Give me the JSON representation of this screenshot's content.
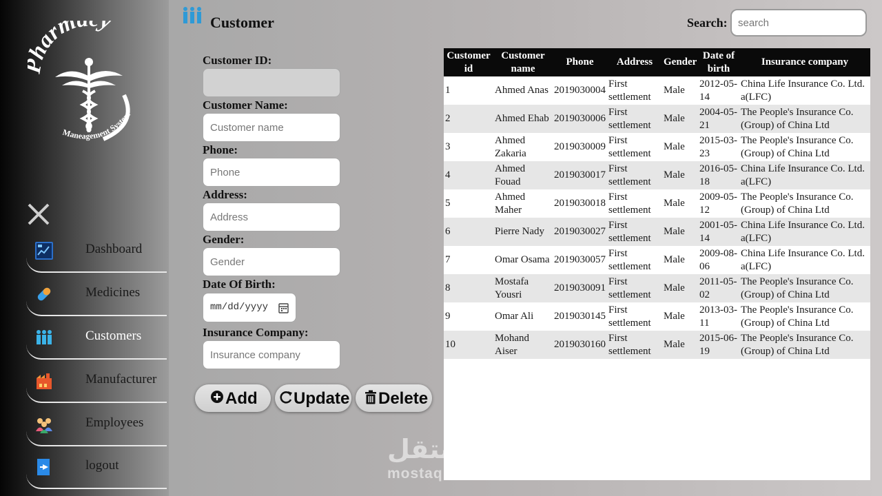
{
  "sidebar": {
    "logo_text": "Pharmacy Maneagement System",
    "items": [
      {
        "label": "Dashboard",
        "icon": "dashboard-icon"
      },
      {
        "label": "Medicines",
        "icon": "pill-icon"
      },
      {
        "label": "Customers",
        "icon": "customers-icon"
      },
      {
        "label": "Manufacturer",
        "icon": "factory-icon"
      },
      {
        "label": "Employees",
        "icon": "employees-icon"
      },
      {
        "label": "logout",
        "icon": "logout-icon"
      }
    ],
    "active_item": "Customers"
  },
  "header": {
    "title": "Customer",
    "icon": "customers-icon",
    "search_label": "Search:",
    "search_placeholder": "search",
    "search_value": ""
  },
  "form": {
    "customer_id_label": "Customer ID:",
    "customer_id_value": "",
    "customer_name_label": "Customer Name:",
    "customer_name_placeholder": "Customer name",
    "phone_label": "Phone:",
    "phone_placeholder": "Phone",
    "address_label": "Address:",
    "address_placeholder": "Address",
    "gender_label": "Gender:",
    "gender_placeholder": "Gender",
    "dob_label": "Date Of Birth:",
    "dob_placeholder": "mm/dd/yyyy",
    "insurance_label": "Insurance Company:",
    "insurance_placeholder": "Insurance company"
  },
  "buttons": {
    "add": "Add",
    "update": "Update",
    "delete": "Delete"
  },
  "table": {
    "columns": [
      "Customer id",
      "Customer name",
      "Phone",
      "Address",
      "Gender",
      "Date of birth",
      "Insurance company"
    ],
    "rows": [
      [
        "1",
        "Ahmed Anas",
        "2019030004",
        "First settlement",
        "Male",
        "2012-05-14",
        "China Life Insurance Co. Ltd. a(LFC)"
      ],
      [
        "2",
        "Ahmed Ehab",
        "2019030006",
        "First settlement",
        "Male",
        "2004-05-21",
        "The People's Insurance Co. (Group) of China Ltd"
      ],
      [
        "3",
        "Ahmed Zakaria",
        "2019030009",
        "First settlement",
        "Male",
        "2015-03-23",
        "The People's Insurance Co. (Group) of China Ltd"
      ],
      [
        "4",
        "Ahmed Fouad",
        "2019030017",
        "First settlement",
        "Male",
        "2016-05-18",
        "China Life Insurance Co. Ltd. a(LFC)"
      ],
      [
        "5",
        "Ahmed Maher",
        "2019030018",
        "First settlement",
        "Male",
        "2009-05-12",
        "The People's Insurance Co. (Group) of China Ltd"
      ],
      [
        "6",
        "Pierre Nady",
        "2019030027",
        "First settlement",
        "Male",
        "2001-05-14",
        "China Life Insurance Co. Ltd. a(LFC)"
      ],
      [
        "7",
        "Omar Osama",
        "2019030057",
        "First settlement",
        "Male",
        "2009-08-06",
        "China Life Insurance Co. Ltd. a(LFC)"
      ],
      [
        "8",
        "Mostafa Yousri",
        "2019030091",
        "First settlement",
        "Male",
        "2011-05-02",
        "The People's Insurance Co. (Group) of China Ltd"
      ],
      [
        "9",
        "Omar Ali",
        "2019030145",
        "First settlement",
        "Male",
        "2013-03-11",
        "The People's Insurance Co. (Group) of China Ltd"
      ],
      [
        "10",
        "Mohand Aiser",
        "2019030160",
        "First settlement",
        "Male",
        "2015-06-19",
        "The People's Insurance Co. (Group) of China Ltd"
      ]
    ]
  },
  "watermark": {
    "arabic": "مستقل",
    "latin": "mostaql.com"
  },
  "colors": {
    "table_header_bg": "#0a0a0a",
    "table_row_alt": "#e6e6e6",
    "sidebar_dark": "#050505"
  }
}
